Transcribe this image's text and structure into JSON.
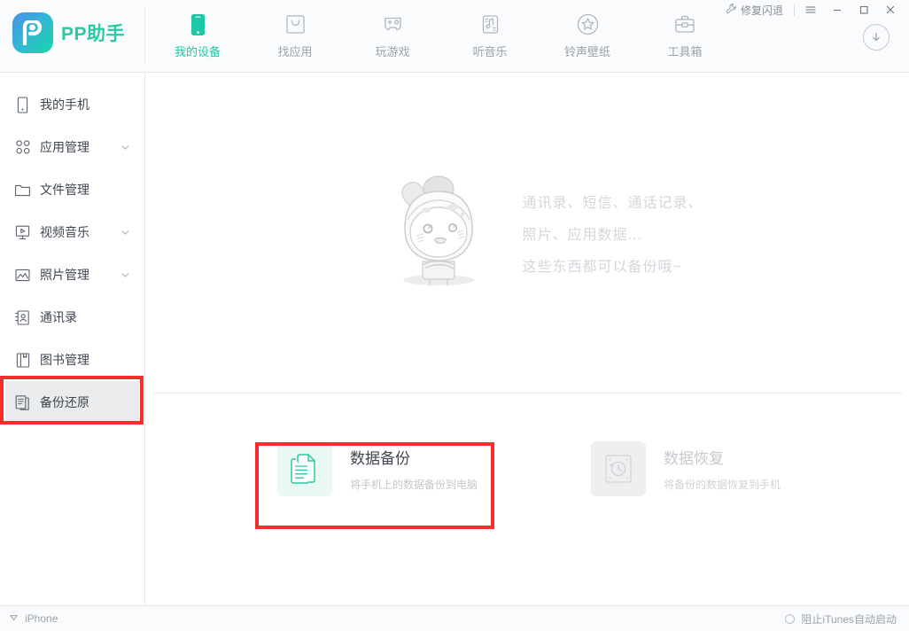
{
  "titlebar": {
    "fix_crash_label": "修复闪退",
    "fix_crash_icon": "wrench-icon",
    "menu_icon": "hamburger-menu-icon",
    "minimize_icon": "minimize-icon",
    "maximize_icon": "maximize-icon",
    "close_icon": "close-icon"
  },
  "header": {
    "logo_text": "PP助手",
    "logo_icon": "pp-logo-icon",
    "download_icon": "download-circle-icon",
    "nav": [
      {
        "label": "我的设备",
        "icon": "phone-icon",
        "active": true
      },
      {
        "label": "找应用",
        "icon": "appbag-icon",
        "active": false
      },
      {
        "label": "玩游戏",
        "icon": "gamepad-icon",
        "active": false
      },
      {
        "label": "听音乐",
        "icon": "music-icon",
        "active": false
      },
      {
        "label": "铃声壁纸",
        "icon": "star-icon",
        "active": false
      },
      {
        "label": "工具箱",
        "icon": "toolbox-icon",
        "active": false
      }
    ]
  },
  "sidebar": {
    "items": [
      {
        "label": "我的手机",
        "icon": "phone-outline-icon",
        "chevron": false,
        "selected": false
      },
      {
        "label": "应用管理",
        "icon": "grid-dots-icon",
        "chevron": true,
        "selected": false
      },
      {
        "label": "文件管理",
        "icon": "folder-icon",
        "chevron": false,
        "selected": false
      },
      {
        "label": "视频音乐",
        "icon": "play-box-icon",
        "chevron": true,
        "selected": false
      },
      {
        "label": "照片管理",
        "icon": "photo-icon",
        "chevron": true,
        "selected": false
      },
      {
        "label": "通讯录",
        "icon": "contacts-icon",
        "chevron": false,
        "selected": false
      },
      {
        "label": "图书管理",
        "icon": "book-icon",
        "chevron": false,
        "selected": false
      },
      {
        "label": "备份还原",
        "icon": "backup-icon",
        "chevron": false,
        "selected": true
      }
    ]
  },
  "main": {
    "hero": {
      "illustration": "mascot-character-illustration",
      "lines": [
        "通讯录、短信、通话记录、",
        "照片、应用数据...",
        "这些东西都可以备份哦~"
      ]
    },
    "cards": [
      {
        "title": "数据备份",
        "subtitle": "将手机上的数据备份到电脑",
        "icon": "documents-icon",
        "disabled": false
      },
      {
        "title": "数据恢复",
        "subtitle": "将备份的数据恢复到手机",
        "icon": "clock-restore-icon",
        "disabled": true
      }
    ]
  },
  "statusbar": {
    "device_label": "iPhone",
    "device_icon": "triangle-down-icon",
    "itunes_label": "阻止iTunes自动启动",
    "itunes_icon": "radio-circle-icon"
  },
  "colors": {
    "accent_teal": "#1ec8a5",
    "annotation_red": "#fb2c2c",
    "text_primary": "#3f4651",
    "text_muted": "#9aa2ab",
    "card_icon_bg": "#eaf8f3",
    "sidebar_selected": "#e9ebed"
  }
}
